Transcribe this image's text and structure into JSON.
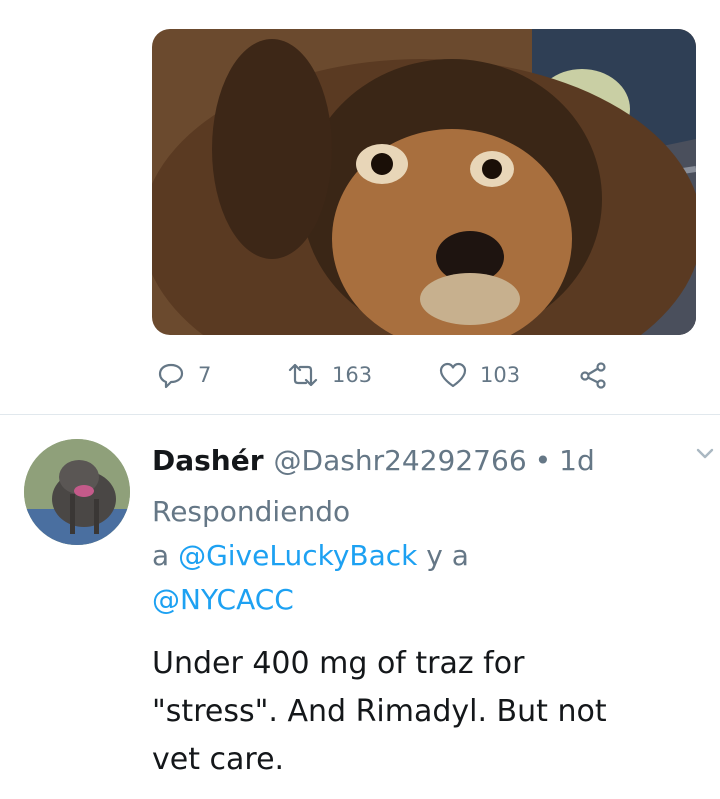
{
  "tweet": {
    "image_alt": "dog photo",
    "actions": {
      "reply_count": "7",
      "retweet_count": "163",
      "like_count": "103"
    }
  },
  "reply": {
    "display_name": "Dashér",
    "handle": "@Dashr24292766",
    "separator": "•",
    "time": "1d",
    "replying_prefix": "Respondiendo",
    "replying_a": "a",
    "mention_1": "@GiveLuckyBack",
    "replying_conj": "y a",
    "mention_2": "@NYCACC",
    "text_line_1": "Under 400 mg of traz for",
    "text_line_2": "\"stress\". And Rimadyl. But not",
    "text_line_3": "vet care."
  },
  "colors": {
    "accent": "#1da1f2",
    "muted": "#657786",
    "divider": "#e1e8ed"
  }
}
